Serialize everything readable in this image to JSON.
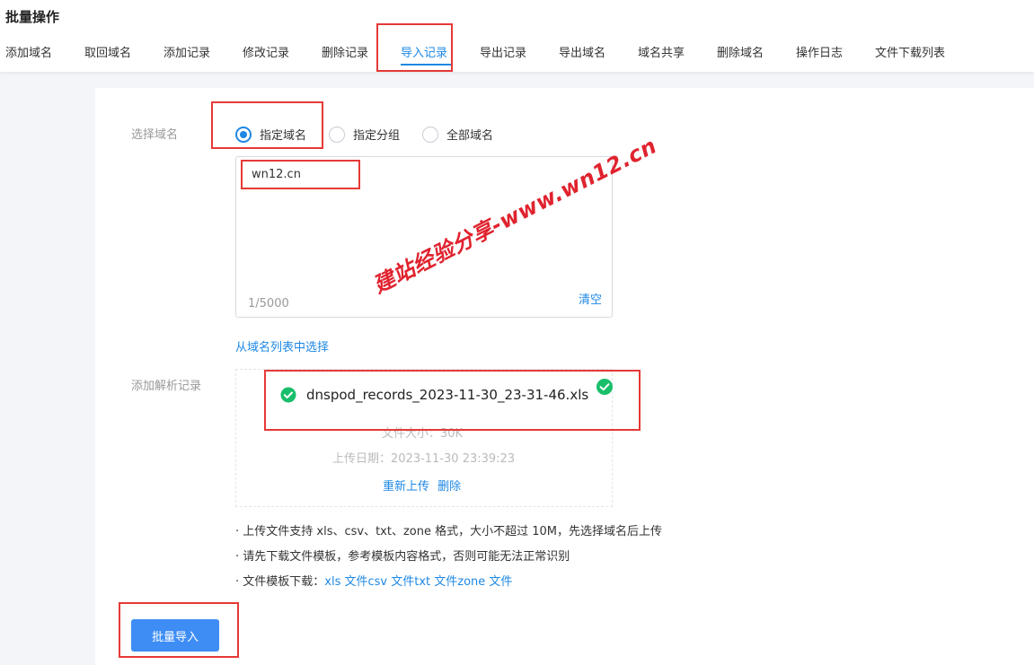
{
  "header": {
    "title": "批量操作",
    "tabs": [
      {
        "label": "添加域名"
      },
      {
        "label": "取回域名"
      },
      {
        "label": "添加记录"
      },
      {
        "label": "修改记录"
      },
      {
        "label": "删除记录"
      },
      {
        "label": "导入记录",
        "active": true
      },
      {
        "label": "导出记录"
      },
      {
        "label": "导出域名"
      },
      {
        "label": "域名共享"
      },
      {
        "label": "删除域名"
      },
      {
        "label": "操作日志"
      },
      {
        "label": "文件下载列表"
      }
    ]
  },
  "form": {
    "select_domain_label": "选择域名",
    "radios": [
      {
        "label": "指定域名",
        "checked": true
      },
      {
        "label": "指定分组",
        "checked": false
      },
      {
        "label": "全部域名",
        "checked": false
      }
    ],
    "domain_textarea": {
      "value": "wn12.cn",
      "count": "1/5000",
      "clear_label": "清空"
    },
    "pick_from_list_link": "从域名列表中选择",
    "add_records_label": "添加解析记录",
    "upload": {
      "file_name": "dnspod_records_2023-11-30_23-31-46.xls",
      "file_size_label": "文件大小：",
      "file_size": "30K",
      "upload_date_label": "上传日期：",
      "upload_date": "2023-11-30 23:39:23",
      "reupload_label": "重新上传",
      "delete_label": "删除",
      "success_color": "#19be6b"
    },
    "tips": [
      "· 上传文件支持 xls、csv、txt、zone 格式，大小不超过 10M，先选择域名后上传",
      "· 请先下载文件模板，参考模板内容格式，否则可能无法正常识别"
    ],
    "template_download": {
      "prefix": "· 文件模板下载：",
      "links": [
        "xls 文件",
        "csv 文件",
        "txt 文件",
        "zone 文件"
      ]
    },
    "submit_label": "批量导入"
  },
  "watermark": "建站经验分享-www.wn12.cn",
  "colors": {
    "accent": "#1e88e5",
    "button": "#3d8df5",
    "highlight_box": "#e53935"
  }
}
